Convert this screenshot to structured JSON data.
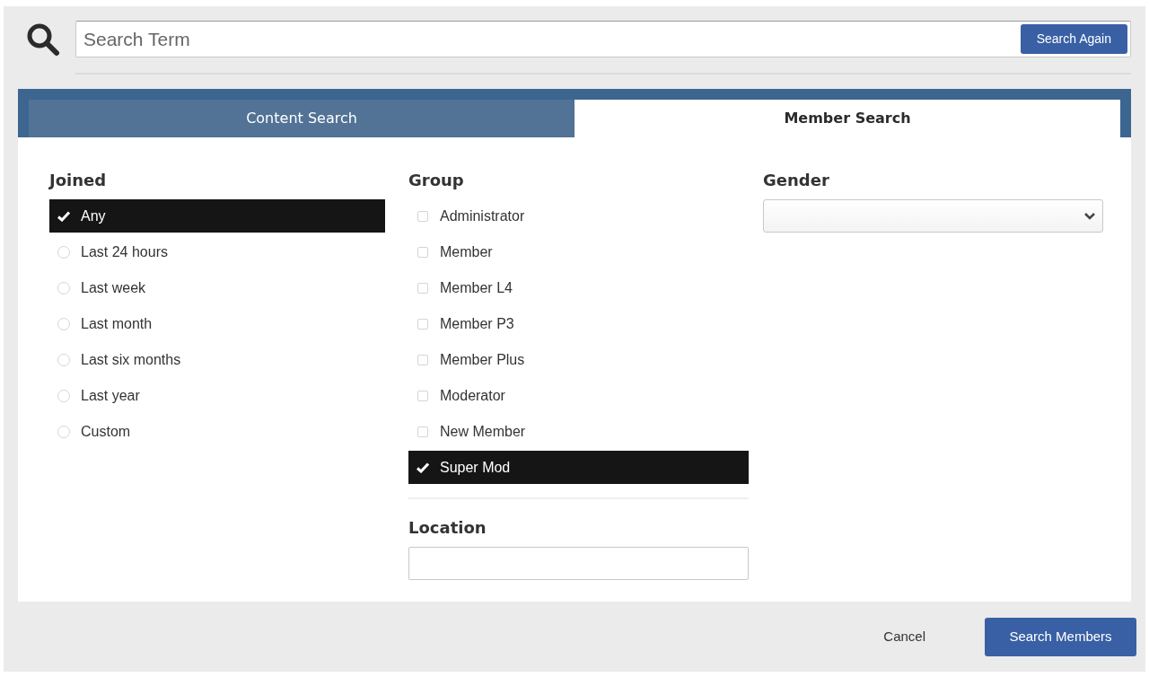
{
  "search": {
    "placeholder": "Search Term",
    "button": "Search Again"
  },
  "tabs": [
    {
      "label": "Content Search",
      "selected": false
    },
    {
      "label": "Member Search",
      "selected": true
    }
  ],
  "joined": {
    "title": "Joined",
    "options": [
      {
        "label": "Any",
        "selected": true
      },
      {
        "label": "Last 24 hours",
        "selected": false
      },
      {
        "label": "Last week",
        "selected": false
      },
      {
        "label": "Last month",
        "selected": false
      },
      {
        "label": "Last six months",
        "selected": false
      },
      {
        "label": "Last year",
        "selected": false
      },
      {
        "label": "Custom",
        "selected": false
      }
    ]
  },
  "group": {
    "title": "Group",
    "options": [
      {
        "label": "Administrator",
        "checked": false
      },
      {
        "label": "Member",
        "checked": false
      },
      {
        "label": "Member L4",
        "checked": false
      },
      {
        "label": "Member P3",
        "checked": false
      },
      {
        "label": "Member Plus",
        "checked": false
      },
      {
        "label": "Moderator",
        "checked": false
      },
      {
        "label": "New Member",
        "checked": false
      },
      {
        "label": "Super Mod",
        "checked": true
      }
    ]
  },
  "location": {
    "title": "Location"
  },
  "gender": {
    "title": "Gender"
  },
  "footer": {
    "cancel": "Cancel",
    "submit": "Search Members"
  }
}
